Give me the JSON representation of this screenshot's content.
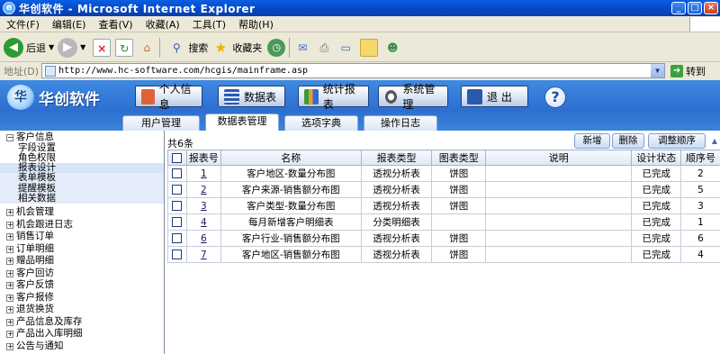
{
  "browser": {
    "title": "华创软件 - Microsoft Internet Explorer",
    "menu": [
      "文件(F)",
      "编辑(E)",
      "查看(V)",
      "收藏(A)",
      "工具(T)",
      "帮助(H)"
    ],
    "toolbar": {
      "back": "后退",
      "search": "搜索",
      "favorites": "收藏夹"
    },
    "address_label": "地址(D)",
    "url": "http://www.hc-software.com/hcgis/mainframe.asp",
    "go": "转到"
  },
  "app": {
    "logo": "华创软件",
    "nav": [
      "个人信息",
      "数据表",
      "统计报表",
      "系统管理",
      "退 出"
    ],
    "help": "?",
    "tabs": [
      "用户管理",
      "数据表管理",
      "选项字典",
      "操作日志"
    ],
    "active_tab": "数据表管理"
  },
  "sidebar": {
    "groups": [
      {
        "label": "客户信息",
        "expanded": true,
        "children": [
          "字段设置",
          "角色权限",
          "报表设计",
          "表单模板",
          "提醒模板",
          "相关数据"
        ]
      },
      {
        "label": "机会管理"
      },
      {
        "label": "机会跟进日志"
      },
      {
        "label": "销售订单"
      },
      {
        "label": "订单明细"
      },
      {
        "label": "赠品明细"
      },
      {
        "label": "客户回访"
      },
      {
        "label": "客户反馈"
      },
      {
        "label": "客户报修"
      },
      {
        "label": "退货换货"
      },
      {
        "label": "产品信息及库存"
      },
      {
        "label": "产品出入库明细"
      },
      {
        "label": "公告与通知"
      }
    ],
    "selected": "报表设计"
  },
  "content": {
    "count": "共6条",
    "actions": {
      "add": "新增",
      "delete": "删除",
      "reorder": "调整顺序"
    },
    "columns": [
      "",
      "报表号",
      "名称",
      "报表类型",
      "图表类型",
      "说明",
      "设计状态",
      "顺序号"
    ],
    "rows": [
      {
        "id": "1",
        "name": "客户地区-数量分布图",
        "type": "透视分析表",
        "chart": "饼图",
        "desc": "",
        "status": "已完成",
        "order": "2"
      },
      {
        "id": "2",
        "name": "客户来源-销售额分布图",
        "type": "透视分析表",
        "chart": "饼图",
        "desc": "",
        "status": "已完成",
        "order": "5"
      },
      {
        "id": "3",
        "name": "客户类型-数量分布图",
        "type": "透视分析表",
        "chart": "饼图",
        "desc": "",
        "status": "已完成",
        "order": "3"
      },
      {
        "id": "4",
        "name": "每月新增客户明细表",
        "type": "分类明细表",
        "chart": "",
        "desc": "",
        "status": "已完成",
        "order": "1"
      },
      {
        "id": "6",
        "name": "客户行业-销售额分布图",
        "type": "透视分析表",
        "chart": "饼图",
        "desc": "",
        "status": "已完成",
        "order": "6"
      },
      {
        "id": "7",
        "name": "客户地区-销售额分布图",
        "type": "透视分析表",
        "chart": "饼图",
        "desc": "",
        "status": "已完成",
        "order": "4"
      }
    ]
  }
}
